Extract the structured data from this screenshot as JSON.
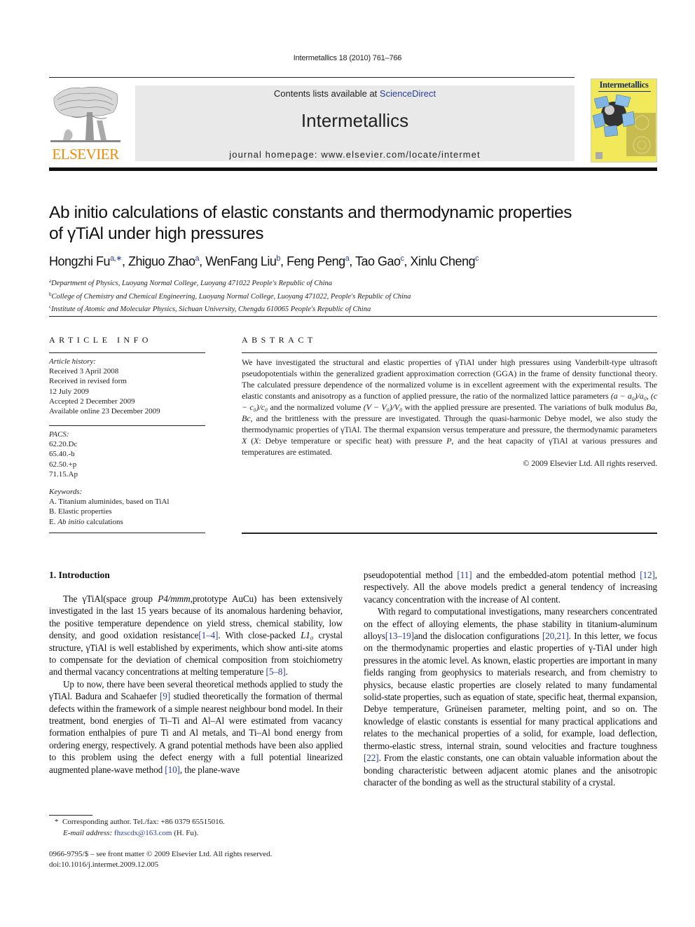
{
  "running_head": "Intermetallics 18 (2010) 761–766",
  "publisher": {
    "logo_word": "ELSEVIER",
    "logo_color": "#f08a00"
  },
  "banner": {
    "contents_prefix": "Contents lists available at ",
    "contents_link": "ScienceDirect",
    "journal_title": "Intermetallics",
    "homepage": "journal homepage: www.elsevier.com/locate/intermet"
  },
  "cover": {
    "title": "Intermetallics",
    "background": "#f2e95a"
  },
  "article": {
    "title_line1": "Ab initio calculations of elastic constants and thermodynamic properties",
    "title_line2": "of γTiAl under high pressures",
    "authors": [
      {
        "name": "Hongzhi Fu",
        "sup": "a,∗",
        "sep": ", "
      },
      {
        "name": "Zhiguo Zhao",
        "sup": "a",
        "sep": ", "
      },
      {
        "name": "WenFang Liu",
        "sup": "b",
        "sep": ", "
      },
      {
        "name": "Feng Peng",
        "sup": "a",
        "sep": ", "
      },
      {
        "name": "Tao Gao",
        "sup": "c",
        "sep": ", "
      },
      {
        "name": "Xinlu Cheng",
        "sup": "c",
        "sep": ""
      }
    ],
    "affiliations": [
      {
        "mark": "a",
        "text": "Department of Physics, Luoyang Normal College, Luoyang 471022 People's Republic of China"
      },
      {
        "mark": "b",
        "text": "College of Chemistry and Chemical Engineering, Luoyang Normal College,  Luoyang 471022, People's Republic of China"
      },
      {
        "mark": "c",
        "text": "Institute of Atomic and Molecular Physics, Sichuan University, Chengdu 610065 People's Republic of China"
      }
    ]
  },
  "article_info": {
    "heading": "ARTICLE INFO",
    "history_label": "Article history:",
    "history": [
      "Received 3 April 2008",
      "Received in revised form",
      "12 July 2009",
      "Accepted 2 December 2009",
      "Available online 23 December 2009"
    ],
    "pacs_label": "PACS:",
    "pacs": [
      "62.20.Dc",
      "65.40.-b",
      "62.50.+p",
      "71.15.Ap"
    ],
    "keywords_label": "Keywords:",
    "keywords": [
      {
        "prefix": "A. ",
        "italic": "",
        "text": "Titanium aluminides, based on TiAl"
      },
      {
        "prefix": "B. ",
        "italic": "",
        "text": "Elastic properties"
      },
      {
        "prefix": "E. ",
        "italic": "Ab initio",
        "text": " calculations"
      }
    ]
  },
  "abstract": {
    "heading": "ABSTRACT",
    "p1": "We have investigated the structural and elastic properties of γTiAl under high pressures using Vanderbilt-type ultrasoft pseudopotentials within the generalized gradient approximation correction (GGA) in the frame of density functional theory. The calculated pressure dependence of the normalized volume is in excellent agreement with the experimental results. The elastic constants and anisotropy as a function of applied pressure, the ratio of the normalized lattice parameters ",
    "expr1": "(a − a₀)/a₀, (c − c₀)/c₀",
    "p2": " and the normalized volume ",
    "expr2": "(V − V₀)/V₀",
    "p3": " with the applied pressure are presented. The variations of bulk modulus ",
    "expr3": "Ba, Bc",
    "p4": ", and the brittleness with the pressure are investigated. Through the quasi-harmonic Debye model, we also study the thermodynamic properties of γTiAl. The thermal expansion versus temperature and pressure, the thermodynamic parameters ",
    "expr4": "X",
    "p5": " (",
    "expr5": "X",
    "p6": ": Debye temperature or specific heat) with pressure ",
    "expr6": "P",
    "p7": ", and the heat capacity of γTiAl at various pressures and temperatures are estimated.",
    "copyright": "© 2009 Elsevier Ltd. All rights reserved."
  },
  "introduction": {
    "heading": "1.  Introduction",
    "left_p1": [
      {
        "t": "The γTiAl(space group "
      },
      {
        "i": "P4/mmm"
      },
      {
        "t": ",prototype AuCu) has been extensively investigated in the last 15 years because of its anomalous hardening behavior, the positive temperature dependence on yield stress, chemical stability, low density, and good oxidation resistance"
      },
      {
        "ref": "[1–4]"
      },
      {
        "t": ". With close-packed "
      },
      {
        "i": "L1₀"
      },
      {
        "t": " crystal structure, γTiAl is well established by experiments, which show anti-site atoms to compensate for the deviation of chemical composition from stoichiometry and thermal vacancy concentrations at melting temperature "
      },
      {
        "ref": "[5–8]"
      },
      {
        "t": "."
      }
    ],
    "left_p2": [
      {
        "t": "Up to now, there have been several theoretical methods applied to study the γTiAl. Badura and Scahaefer "
      },
      {
        "ref": "[9]"
      },
      {
        "t": " studied theoretically the formation of thermal defects within the framework of a simple nearest neighbour bond model. In their treatment, bond energies of Ti–Ti and Al–Al were estimated from vacancy formation enthalpies of pure Ti and Al metals, and Ti–Al bond energy from ordering energy, respectively. A grand potential methods have been also applied to this problem using the defect energy with a full potential linearized augmented plane-wave method "
      },
      {
        "ref": "[10]"
      },
      {
        "t": ", the plane-wave"
      }
    ],
    "right_p1": [
      {
        "t": "pseudopotential method "
      },
      {
        "ref": "[11]"
      },
      {
        "t": " and the embedded-atom potential method "
      },
      {
        "ref": "[12]"
      },
      {
        "t": ", respectively. All the above models predict a general tendency of increasing vacancy concentration with the increase of Al content."
      }
    ],
    "right_p2": [
      {
        "t": "With regard to computational investigations, many researchers concentrated on the effect of alloying elements, the phase stability in titanium-aluminum alloys"
      },
      {
        "ref": "[13–19]"
      },
      {
        "t": "and the dislocation configurations "
      },
      {
        "ref": "[20,21]"
      },
      {
        "t": ". In this letter, we focus on the thermodynamic properties and elastic properties of γ-TiAl under high pressures in the atomic level. As known, elastic properties are important in many fields ranging from geophysics to materials research, and from chemistry to physics, because elastic properties are closely related to many fundamental solid-state properties, such as equation of state, specific heat, thermal expansion, Debye temperature, Grüneisen parameter, melting point, and so on. The knowledge of elastic constants is essential for many practical applications and relates to the mechanical properties of a solid, for example, load deflection, thermo-elastic stress, internal strain, sound velocities and fracture toughness "
      },
      {
        "ref": "[22]"
      },
      {
        "t": ". From the elastic constants, one can obtain valuable information about the bonding characteristic between adjacent atomic planes and the anisotropic character of the bonding as well as the structural stability of a crystal."
      }
    ]
  },
  "footnote": {
    "star": "*",
    "corresponding": "Corresponding author. Tel./fax: +86 0379 65515016.",
    "email_label": "E-mail address: ",
    "email": "fhzscdx@163.com",
    "email_suffix": " (H. Fu)."
  },
  "front_matter": {
    "line1": "0966-9795/$ – see front matter © 2009 Elsevier Ltd. All rights reserved.",
    "line2": "doi:10.1016/j.intermet.2009.12.005"
  },
  "colors": {
    "link": "#2a3f9a",
    "banner_bg": "#e9e9e9"
  }
}
